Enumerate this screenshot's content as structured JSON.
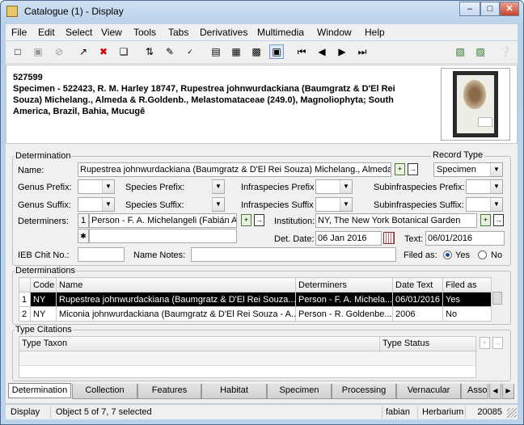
{
  "window": {
    "title": "Catalogue (1) - Display",
    "btn_min": "–",
    "btn_max": "□",
    "btn_close": "✕"
  },
  "menu": [
    "File",
    "Edit",
    "Select",
    "View",
    "Tools",
    "Tabs",
    "Derivatives",
    "Multimedia",
    "Window",
    "Help"
  ],
  "summary": {
    "id": "527599",
    "text": "Specimen - 522423, R. M. Harley 18747, Rupestrea johnwurdackiana (Baumgratz & D'El Rei Souza) Michelang., Almeda & R.Goldenb., Melastomataceae (249.0), Magnoliophyta;  South America, Brazil, Bahia, Mucugê"
  },
  "determination": {
    "legend": "Determination",
    "name_label": "Name:",
    "name_value": "Rupestrea johnwurdackiana (Baumgratz & D'El Rei Souza) Michelang., Almeda &",
    "record_type_label": "Record Type",
    "record_type_value": "Specimen",
    "genus_prefix_label": "Genus Prefix:",
    "species_prefix_label": "Species Prefix:",
    "infraspecies_prefix_label": "Infraspecies Prefix",
    "subinfraspecies_prefix_label": "Subinfraspecies Prefix:",
    "genus_suffix_label": "Genus Suffix:",
    "species_suffix_label": "Species Suffix:",
    "infraspecies_suffix_label": "Infraspecies Suffix",
    "subinfraspecies_suffix_label": "Subinfraspecies Suffix:",
    "determiners_label": "Determiners:",
    "determiner_row_num": "1",
    "determiner_value": "Person - F. A. Michelangeli (Fabián Ar...",
    "determiner_new_row": "✱",
    "institution_label": "Institution:",
    "institution_value": "NY, The New York Botanical Garden",
    "det_date_label": "Det. Date:",
    "det_date_value": "06 Jan 2016",
    "text_label": "Text:",
    "text_value": "06/01/2016",
    "ieb_label": "IEB Chit No.:",
    "name_notes_label": "Name Notes:",
    "filed_as_label": "Filed as:",
    "filed_yes": "Yes",
    "filed_no": "No"
  },
  "determinations": {
    "legend": "Determinations",
    "columns": [
      "Code",
      "Name",
      "Determiners",
      "Date Text",
      "Filed as"
    ],
    "rows": [
      {
        "num": "1",
        "code": "NY",
        "name": "Rupestrea johnwurdackiana (Baumgratz & D'El Rei Souza...",
        "determiners": "Person - F. A. Michela...",
        "date": "06/01/2016",
        "filed": "Yes"
      },
      {
        "num": "2",
        "code": "NY",
        "name": "Miconia johnwurdackiana (Baumgratz & D'El Rei Souza - A...",
        "determiners": "Person - R. Goldenbe...",
        "date": "2006",
        "filed": "No"
      }
    ]
  },
  "type_citations": {
    "legend": "Type Citations",
    "columns": [
      "Type Taxon",
      "Type Status"
    ]
  },
  "tabs": [
    "Determination",
    "Collection",
    "Features",
    "Habitat",
    "Specimen",
    "Processing",
    "Vernacular",
    "Asso"
  ],
  "status": {
    "mode": "Display",
    "selection": "Object 5 of 7, 7 selected",
    "user": "fabian",
    "database": "Herbarium",
    "port": "20085"
  }
}
